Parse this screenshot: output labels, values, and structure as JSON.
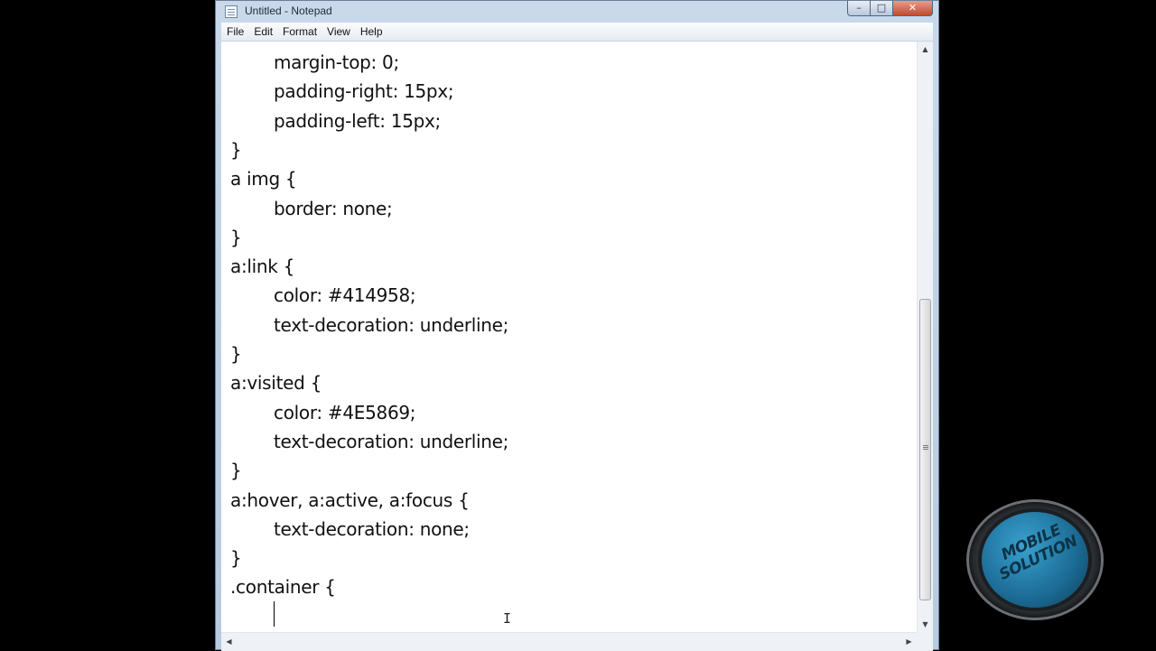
{
  "window": {
    "title": "Untitled - Notepad",
    "controls": {
      "minimize": "–",
      "maximize": "□",
      "close": "✕"
    }
  },
  "menu": [
    "File",
    "Edit",
    "Format",
    "View",
    "Help"
  ],
  "editor": {
    "lines": [
      {
        "text": "margin-top: 0;",
        "indent": true
      },
      {
        "text": "padding-right: 15px;",
        "indent": true
      },
      {
        "text": "padding-left: 15px;",
        "indent": true
      },
      {
        "text": "}",
        "indent": false
      },
      {
        "text": "a img {",
        "indent": false
      },
      {
        "text": "border: none;",
        "indent": true
      },
      {
        "text": "}",
        "indent": false
      },
      {
        "text": "a:link {",
        "indent": false
      },
      {
        "text": "color: #414958;",
        "indent": true
      },
      {
        "text": "text-decoration: underline;",
        "indent": true
      },
      {
        "text": "}",
        "indent": false
      },
      {
        "text": "a:visited {",
        "indent": false
      },
      {
        "text": "color: #4E5869;",
        "indent": true
      },
      {
        "text": "text-decoration: underline;",
        "indent": true
      },
      {
        "text": "}",
        "indent": false
      },
      {
        "text": "a:hover, a:active, a:focus {",
        "indent": false
      },
      {
        "text": "text-decoration: none;",
        "indent": true
      },
      {
        "text": "}",
        "indent": false
      },
      {
        "text": ".container {",
        "indent": false
      }
    ]
  },
  "scrollbar": {
    "up_icon": "triangle-up",
    "down_icon": "triangle-down",
    "position": 0.9
  },
  "watermark": {
    "text_line1": "MOBILE",
    "text_line2": "SOLUTION"
  },
  "colors": {
    "titlebar": "#c9d9ea",
    "editor_bg": "#ffffff",
    "logo_ring": "#2e3236",
    "logo_face": "#3aa1cf"
  }
}
